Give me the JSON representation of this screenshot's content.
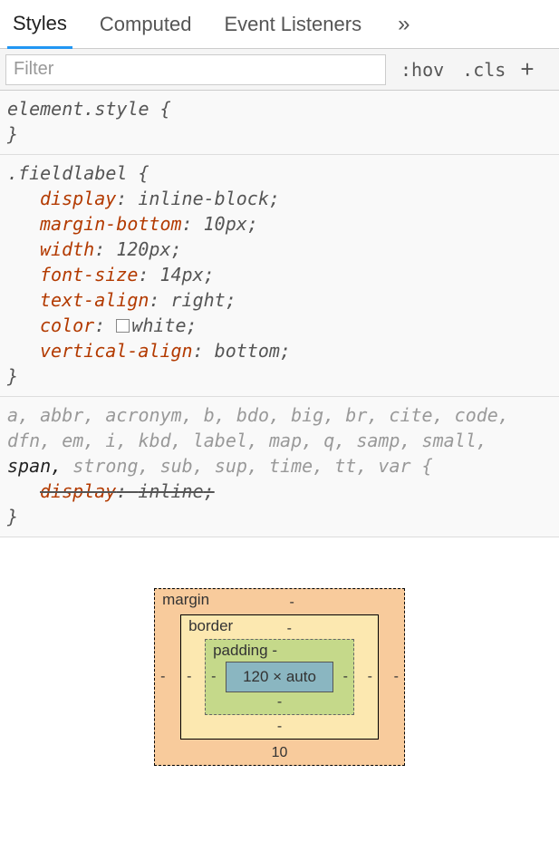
{
  "tabs": {
    "styles": "Styles",
    "computed": "Computed",
    "listeners": "Event Listeners"
  },
  "filter": {
    "placeholder": "Filter",
    "hov": ":hov",
    "cls": ".cls"
  },
  "rules": {
    "element_style": {
      "selector": "element.style",
      "open": "{",
      "close": "}"
    },
    "fieldlabel": {
      "selector": ".fieldlabel",
      "open": "{",
      "close": "}",
      "decls": [
        {
          "prop": "display",
          "val": "inline-block"
        },
        {
          "prop": "margin-bottom",
          "val": "10px"
        },
        {
          "prop": "width",
          "val": "120px"
        },
        {
          "prop": "font-size",
          "val": "14px"
        },
        {
          "prop": "text-align",
          "val": "right"
        },
        {
          "prop": "color",
          "val": "white",
          "swatch": true
        },
        {
          "prop": "vertical-align",
          "val": "bottom"
        }
      ]
    },
    "ua": {
      "selector_parts": {
        "pre": "a, abbr, acronym, b, bdo, big, br, cite, code, dfn, em, i, kbd, label, map, q, samp, small, ",
        "match": "span,",
        "post": " strong, sub, sup, time, tt, var {"
      },
      "close": "}",
      "decl": {
        "prop": "display",
        "val": "inline"
      }
    }
  },
  "boxmodel": {
    "margin_label": "margin",
    "border_label": "border",
    "padding_label": "padding",
    "content": "120 × auto",
    "margin": {
      "top": "-",
      "right": "-",
      "bottom": "10",
      "left": "-"
    },
    "border": {
      "top": "-",
      "right": "-",
      "bottom": "-",
      "left": "-"
    },
    "padding": {
      "top": "-",
      "right": "-",
      "bottom": "-",
      "left": "-"
    }
  }
}
